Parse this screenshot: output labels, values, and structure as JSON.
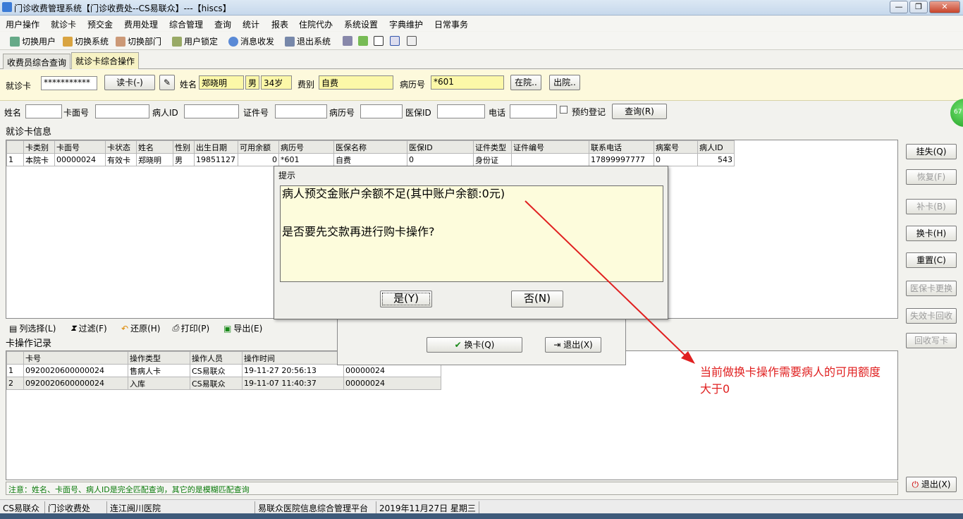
{
  "window": {
    "title": "门诊收费管理系统【门诊收费处--CS易联众】---【hiscs】",
    "btn_min": "—",
    "btn_max": "❐",
    "btn_close": "✕"
  },
  "menu": [
    "用户操作",
    "就诊卡",
    "预交金",
    "费用处理",
    "综合管理",
    "查询",
    "统计",
    "报表",
    "住院代办",
    "系统设置",
    "字典维护",
    "日常事务"
  ],
  "toolbar": [
    "切换用户",
    "切换系统",
    "切换部门",
    "用户锁定",
    "消息收发",
    "退出系统"
  ],
  "tabs": [
    "收费员综合查询",
    "就诊卡综合操作"
  ],
  "cardbar": {
    "card_label": "就诊卡",
    "card_value": "***********",
    "read_btn": "读卡(-)",
    "name_label": "姓名",
    "name_value": "郑晓明",
    "sex_value": "男",
    "age_value": "34岁",
    "fee_label": "费别",
    "fee_value": "自费",
    "record_label": "病历号",
    "record_value": "*601",
    "inhosp_btn": "在院..",
    "discharge_btn": "出院.."
  },
  "search": {
    "name": "姓名",
    "cardno": "卡面号",
    "patient_id": "病人ID",
    "cert_no": "证件号",
    "record_no": "病历号",
    "insure_id": "医保ID",
    "phone": "电话",
    "reserve": "预约登记",
    "query_btn": "查询(R)",
    "badge": "67"
  },
  "cardinfo": {
    "title": "就诊卡信息",
    "headers": [
      "",
      "卡类别",
      "卡面号",
      "卡状态",
      "姓名",
      "性别",
      "出生日期",
      "可用余额",
      "病历号",
      "医保名称",
      "医保ID",
      "证件类型",
      "证件编号",
      "联系电话",
      "病案号",
      "病人ID"
    ],
    "rows": [
      [
        "1",
        "本院卡",
        "00000024",
        "有效卡",
        "郑晓明",
        "男",
        "19851127",
        "0",
        "*601",
        "自费",
        "0",
        "身份证",
        "",
        "17899997777",
        "0",
        "543"
      ]
    ]
  },
  "side_buttons": {
    "lost": "挂失(Q)",
    "restore": "恢复(F)",
    "reissue": "补卡(B)",
    "change": "换卡(H)",
    "reset": "重置(C)",
    "insure_change": "医保卡更换",
    "invalid_recycle": "失效卡回收",
    "recycle_write": "回收写卡",
    "exit": "退出(X)"
  },
  "grid_tools": [
    "列选择(L)",
    "过滤(F)",
    "还原(H)",
    "打印(P)",
    "导出(E)"
  ],
  "ops": {
    "title": "卡操作记录",
    "headers": [
      "",
      "卡号",
      "操作类型",
      "操作人员",
      "操作时间",
      ""
    ],
    "rows": [
      [
        "1",
        "0920020600000024",
        "售病人卡",
        "CS易联众",
        "19-11-27 20:56:13",
        "00000024"
      ],
      [
        "2",
        "0920020600000024",
        "入库",
        "CS易联众",
        "19-11-07 11:40:37",
        "00000024"
      ]
    ]
  },
  "note": "注意：姓名、卡面号、病人ID是完全匹配查询，其它的是模糊匹配查询",
  "status": [
    "CS易联众",
    "门诊收费处",
    "连江闽川医院",
    "易联众医院信息综合管理平台",
    "2019年11月27日 星期三"
  ],
  "bg_dialog": {
    "change_btn": "换卡(Q)",
    "exit_btn": "退出(X)"
  },
  "dialog": {
    "title": "提示",
    "line1": "病人预交金账户余额不足(其中账户余额:0元)",
    "line2": "是否要先交款再进行购卡操作?",
    "yes": "是(Y)",
    "no": "否(N)"
  },
  "annotation": {
    "line1": "当前做换卡操作需要病人的可用额度",
    "line2": "大于0",
    "color": "#e02020"
  }
}
